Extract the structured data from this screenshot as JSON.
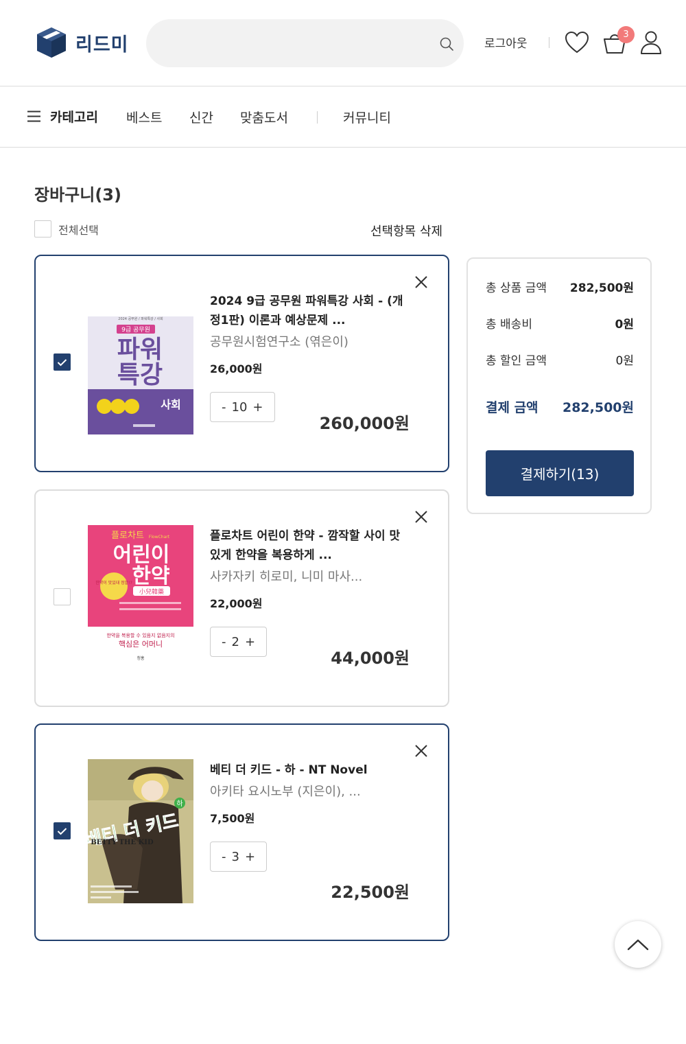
{
  "header": {
    "logo_text": "리드미",
    "search_placeholder": "",
    "logout_label": "로그아웃",
    "cart_count": "3"
  },
  "nav": {
    "category_label": "카테고리",
    "items": [
      "베스트",
      "신간",
      "맞춤도서",
      "커뮤니티"
    ]
  },
  "cart": {
    "title": "장바구니(3)",
    "select_all_label": "전체선택",
    "delete_selected_label": "선택항목 삭제",
    "items": [
      {
        "selected": true,
        "title": "2024 9급 공무원 파워특강 사회 - (개정1판) 이론과 예상문제 ...",
        "author": "공무원시험연구소 (엮은이)",
        "unit_price": "26,000원",
        "quantity": "10",
        "total": "260,000원",
        "cover": {
          "top_text": "2024 공무원 / 파워특강 / 사회",
          "badge": "9급 공무원",
          "main_line1": "파워",
          "main_line2": "특강",
          "subject": "사회",
          "bg": "#e9e6f2",
          "band": "#6a4f9d",
          "accent": "#d4418e",
          "circle": "#f2d21b"
        }
      },
      {
        "selected": false,
        "title": "플로차트 어린이 한약 - 깜작할 사이 맛있게 한약을 복용하게 ...",
        "author": "사카자키 히로미, 니미 마사...",
        "unit_price": "22,000원",
        "quantity": "2",
        "total": "44,000원",
        "cover": {
          "top_text": "플로차트",
          "top_small": "FlowChart",
          "main_line1": "어린이",
          "main_line2": "한약",
          "hanja": "小兒韓藥",
          "badge": "한약이 맛있대 정말!?",
          "bottom_small": "한약을 복용할 수 있음지 없음지의",
          "bottom_main": "핵심은 어머니",
          "publisher": "청홍",
          "bg": "#e8447c",
          "accent": "#f5d94a"
        }
      },
      {
        "selected": true,
        "title": "베티 더 키드 - 하 - NT Novel",
        "author": "아키타 요시노부 (지은이), ...",
        "unit_price": "7,500원",
        "quantity": "3",
        "total": "22,500원",
        "cover": {
          "title_ko": "베티 더 키드",
          "title_en": "BETTY THE KID",
          "volume": "하",
          "bg": "#c9c08f",
          "coat": "#3a3026",
          "hair": "#e8d27a",
          "title_color": "#3fb04a"
        }
      }
    ]
  },
  "summary": {
    "total_product_label": "총 상품 금액",
    "total_product_value": "282,500원",
    "shipping_label": "총 배송비",
    "shipping_value": "0원",
    "discount_label": "총 할인 금액",
    "discount_value": "0원",
    "pay_amount_label": "결제 금액",
    "pay_amount_value": "282,500원",
    "pay_button_label": "결제하기(13)"
  },
  "colors": {
    "brand": "#22406e",
    "badge": "#f27a7a",
    "border": "#dcdcdc"
  },
  "icons": [
    "search-icon",
    "heart-icon",
    "cart-icon",
    "user-icon",
    "menu-icon",
    "close-icon",
    "check-icon",
    "chevron-up-icon"
  ]
}
